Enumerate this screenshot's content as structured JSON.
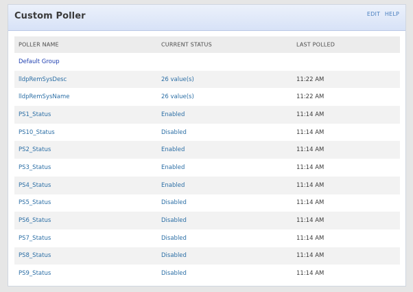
{
  "widget": {
    "title": "Custom Poller",
    "edit_label": "EDIT",
    "help_label": "HELP"
  },
  "table": {
    "columns": [
      "POLLER NAME",
      "CURRENT STATUS",
      "LAST POLLED"
    ],
    "group_label": "Default Group",
    "rows": [
      {
        "name": "lldpRemSysDesc",
        "status": "26 value(s)",
        "last": "11:22 AM"
      },
      {
        "name": "lldpRemSysName",
        "status": "26 value(s)",
        "last": "11:22 AM"
      },
      {
        "name": "PS1_Status",
        "status": "Enabled",
        "last": "11:14 AM"
      },
      {
        "name": "PS10_Status",
        "status": "Disabled",
        "last": "11:14 AM"
      },
      {
        "name": "PS2_Status",
        "status": "Enabled",
        "last": "11:14 AM"
      },
      {
        "name": "PS3_Status",
        "status": "Enabled",
        "last": "11:14 AM"
      },
      {
        "name": "PS4_Status",
        "status": "Enabled",
        "last": "11:14 AM"
      },
      {
        "name": "PS5_Status",
        "status": "Disabled",
        "last": "11:14 AM"
      },
      {
        "name": "PS6_Status",
        "status": "Disabled",
        "last": "11:14 AM"
      },
      {
        "name": "PS7_Status",
        "status": "Disabled",
        "last": "11:14 AM"
      },
      {
        "name": "PS8_Status",
        "status": "Disabled",
        "last": "11:14 AM"
      },
      {
        "name": "PS9_Status",
        "status": "Disabled",
        "last": "11:14 AM"
      }
    ]
  },
  "colors": {
    "header_gradient_top": "#ecf1fb",
    "header_gradient_bottom": "#d7e2f7",
    "link": "#2b6ea5",
    "group_link": "#1f3fb0",
    "row_alt": "#f2f2f2"
  }
}
